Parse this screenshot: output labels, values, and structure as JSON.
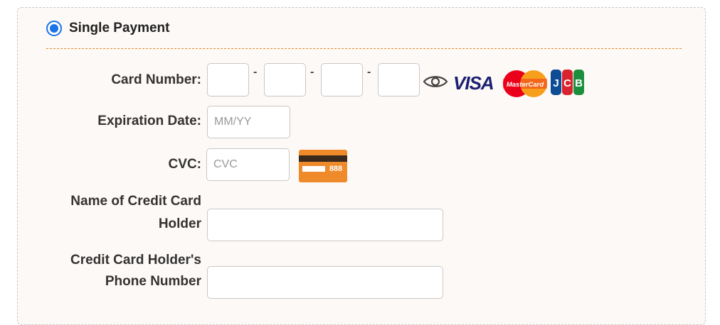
{
  "payment": {
    "option_label": "Single Payment",
    "selected": true
  },
  "form": {
    "card_number_label": "Card Number:",
    "separator": "-",
    "expiration_label": "Expiration Date:",
    "expiration_placeholder": "MM/YY",
    "cvc_label": "CVC:",
    "cvc_placeholder": "CVC",
    "holder_name_label_line1": "Name of Credit Card",
    "holder_name_label_line2": "Holder",
    "holder_phone_label_line1": "Credit Card Holder's",
    "holder_phone_label_line2": "Phone Number"
  },
  "brands": {
    "visa": "VISA",
    "mastercard": "MasterCard",
    "jcb": "JCB"
  },
  "cvc_graphic_text": "888",
  "icons": {
    "reveal": "eye-icon"
  },
  "colors": {
    "accent": "#1a73e8",
    "divider": "#e08a2a",
    "cvc_card": "#ef8a2a",
    "panel_bg": "#fdf9f6"
  }
}
